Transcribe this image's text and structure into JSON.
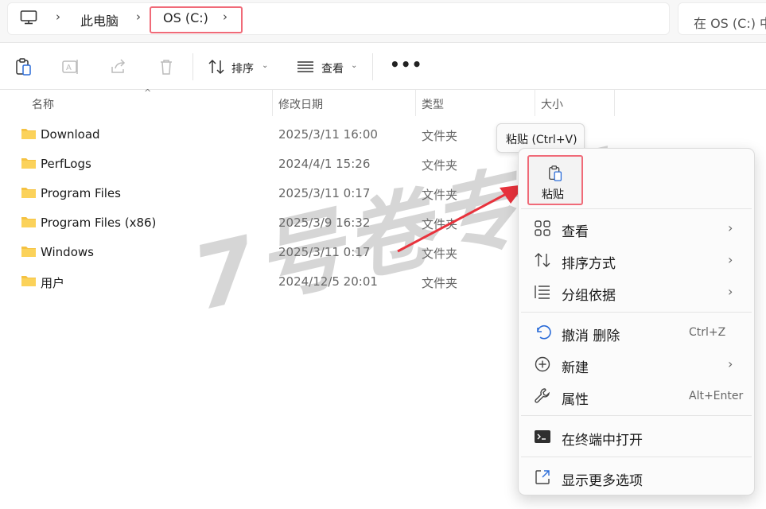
{
  "address": {
    "breadcrumb": [
      "此电脑",
      "OS (C:)"
    ],
    "search_placeholder": "在 OS (C:) 中"
  },
  "toolbar": {
    "sort_label": "排序",
    "view_label": "查看",
    "more_label": "•••"
  },
  "columns": {
    "name": "名称",
    "modified": "修改日期",
    "type": "类型",
    "size": "大小"
  },
  "files": [
    {
      "name": "Download",
      "modified": "2025/3/11 16:00",
      "type": "文件夹"
    },
    {
      "name": "PerfLogs",
      "modified": "2024/4/1 15:26",
      "type": "文件夹"
    },
    {
      "name": "Program Files",
      "modified": "2025/3/11 0:17",
      "type": "文件夹"
    },
    {
      "name": "Program Files (x86)",
      "modified": "2025/3/9 16:32",
      "type": "文件夹"
    },
    {
      "name": "Windows",
      "modified": "2025/3/11 0:17",
      "type": "文件夹"
    },
    {
      "name": "用户",
      "modified": "2024/12/5 20:01",
      "type": "文件夹"
    }
  ],
  "tooltip": "粘贴 (Ctrl+V)",
  "context_menu": {
    "paste_label": "粘贴",
    "items": [
      {
        "label": "查看",
        "shortcut": "",
        "submenu": true
      },
      {
        "label": "排序方式",
        "shortcut": "",
        "submenu": true
      },
      {
        "label": "分组依据",
        "shortcut": "",
        "submenu": true
      },
      {
        "label": "撤消 删除",
        "shortcut": "Ctrl+Z",
        "submenu": false
      },
      {
        "label": "新建",
        "shortcut": "",
        "submenu": true
      },
      {
        "label": "属性",
        "shortcut": "Alt+Enter",
        "submenu": false
      },
      {
        "label": "在终端中打开",
        "shortcut": "",
        "submenu": false
      },
      {
        "label": "显示更多选项",
        "shortcut": "",
        "submenu": false
      }
    ]
  },
  "watermark": "7号卷专用",
  "colors": {
    "highlight_red": "#f06a78",
    "folder_yellow": "#f5c242",
    "accent_blue": "#2b6cd8"
  }
}
